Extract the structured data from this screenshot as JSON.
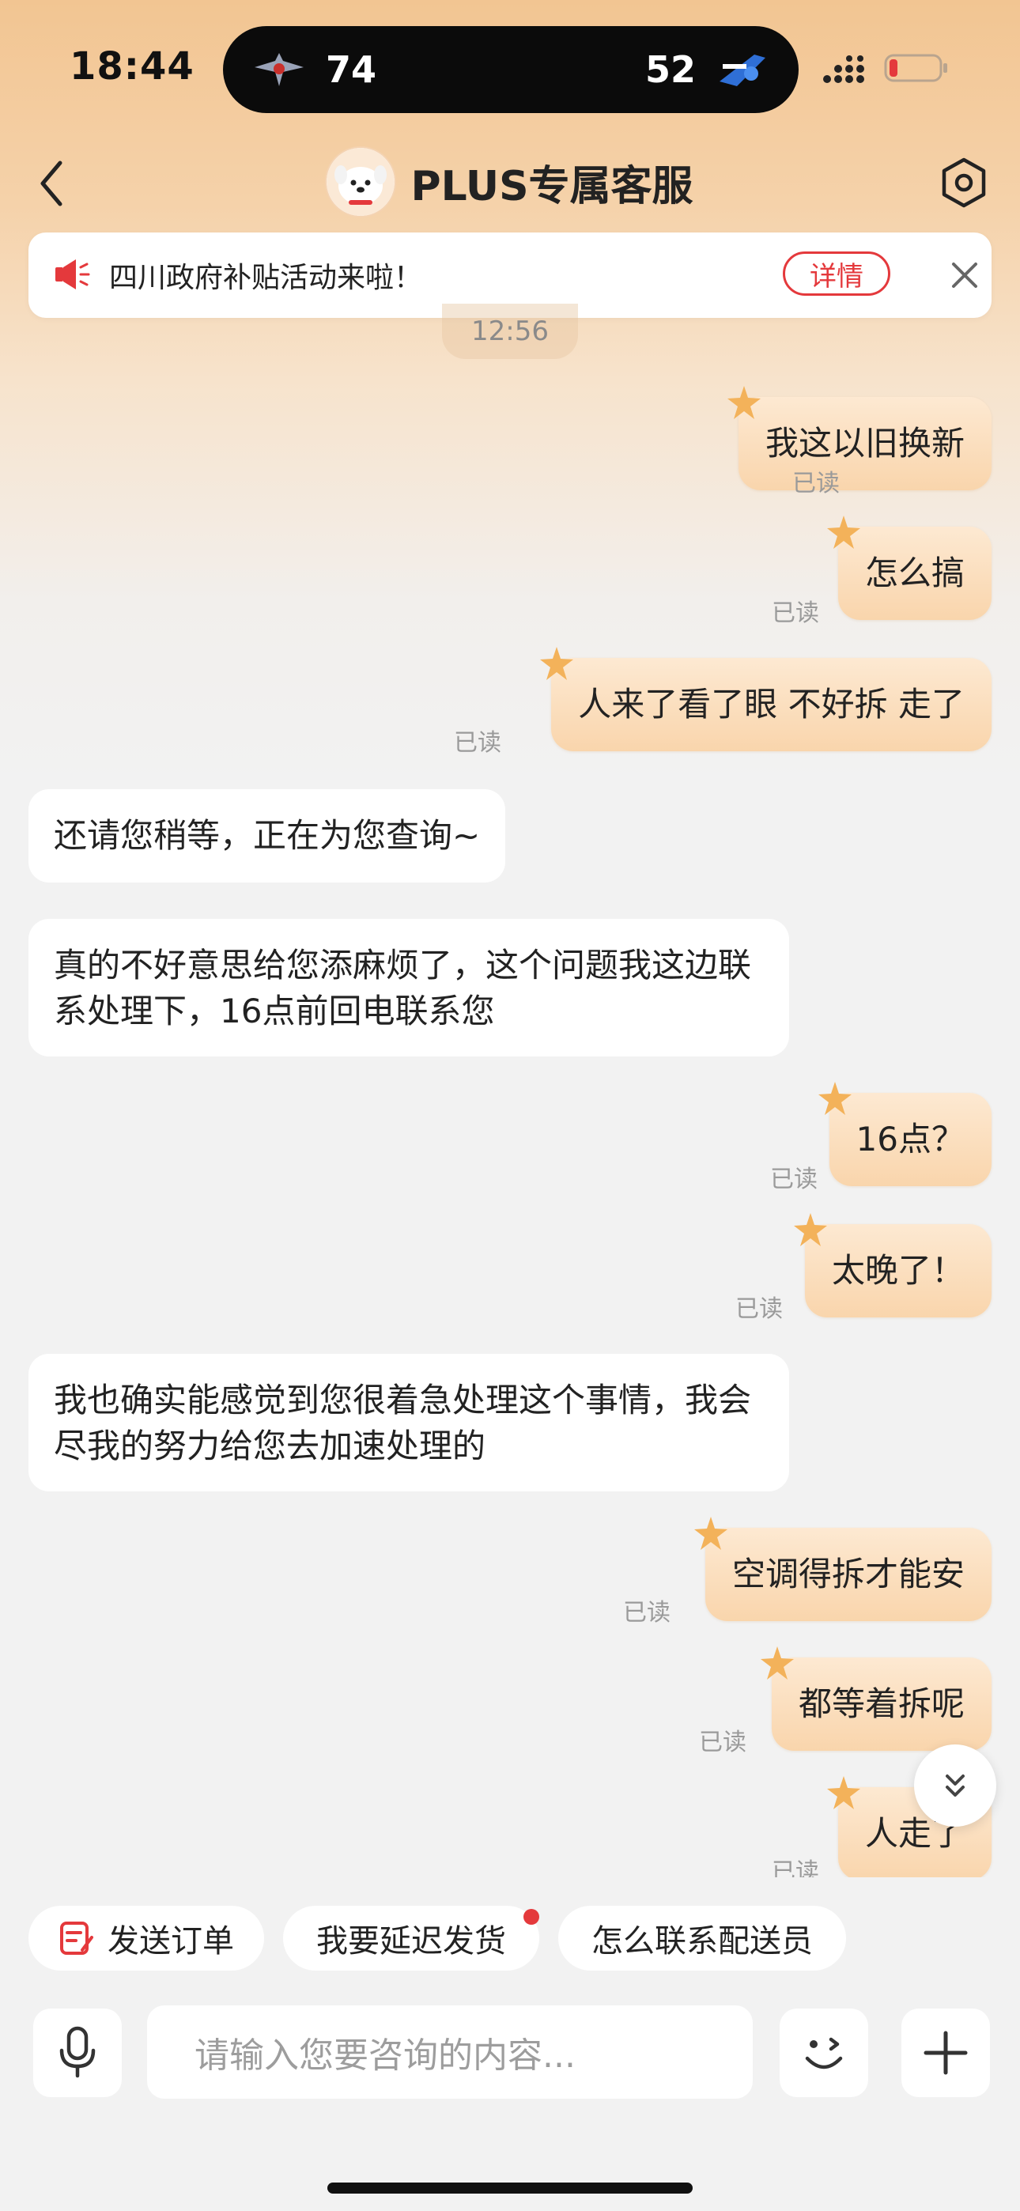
{
  "status_bar": {
    "time": "18:44",
    "live_activity": {
      "left_score": "74",
      "right_score": "52"
    }
  },
  "header": {
    "title": "PLUS专属客服"
  },
  "notice": {
    "text": "四川政府补贴活动来啦！",
    "detail_label": "详情"
  },
  "timestamp": "12:56",
  "messages": [
    {
      "side": "out",
      "text": "我这以旧换新",
      "read": "已读"
    },
    {
      "side": "out",
      "text": "怎么搞",
      "read": "已读"
    },
    {
      "side": "out",
      "text": "人来了看了眼 不好拆 走了",
      "read": "已读"
    },
    {
      "side": "in",
      "text": "还请您稍等，正在为您查询~"
    },
    {
      "side": "in",
      "text": "真的不好意思给您添麻烦了，这个问题我这边联系处理下，16点前回电联系您"
    },
    {
      "side": "out",
      "text": "16点？",
      "read": "已读"
    },
    {
      "side": "out",
      "text": "太晚了！",
      "read": "已读"
    },
    {
      "side": "in",
      "text": "我也确实能感觉到您很着急处理这个事情，我会尽我的努力给您去加速处理的"
    },
    {
      "side": "out",
      "text": "空调得拆才能安",
      "read": "已读"
    },
    {
      "side": "out",
      "text": "都等着拆呢",
      "read": "已读"
    },
    {
      "side": "out",
      "text": "人走了",
      "read": "已读"
    }
  ],
  "quick_replies": [
    "发送订单",
    "我要延迟发货",
    "怎么联系配送员"
  ],
  "input": {
    "placeholder": "请输入您要咨询的内容..."
  },
  "colors": {
    "accent": "#e4393c",
    "bubble_out": "#f9d5ac",
    "bubble_in": "#ffffff"
  }
}
